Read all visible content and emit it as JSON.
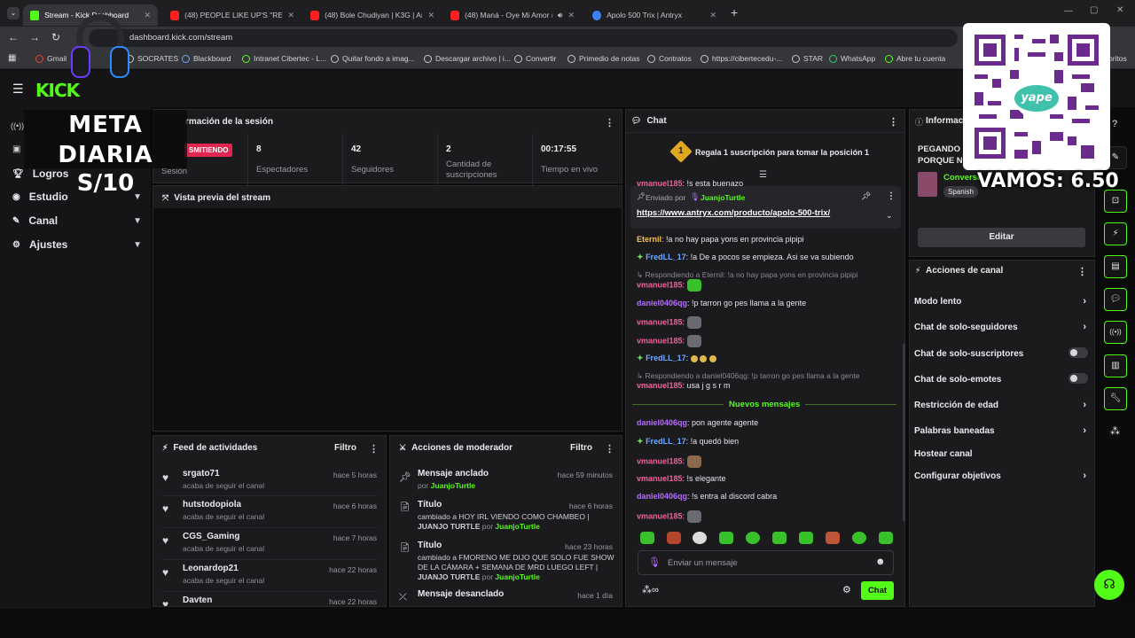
{
  "browser": {
    "tabs": [
      {
        "title": "Stream - Kick Dashboard",
        "icon": "kick"
      },
      {
        "title": "(48) PEOPLE LIKE UP'S \"REENCA",
        "icon": "youtube"
      },
      {
        "title": "(48) Bole Chudiyan | K3G | Ami",
        "icon": "youtube"
      },
      {
        "title": "(48) Maná - Oye Mi Amor (",
        "icon": "youtube"
      },
      {
        "title": "Apolo 500 Trix | Antryx",
        "icon": "antryx"
      }
    ],
    "url": "dashboard.kick.com/stream",
    "bookmarks": [
      "Gmail",
      "SOCRATES",
      "Blackboard",
      "Intranet Cibertec - L...",
      "Quitar fondo a imag...",
      "Descargar archivo | i...",
      "Convertir",
      "Primedio de notas",
      "Contratos",
      "https://cibertecedu-...",
      "STAR",
      "WhatsApp",
      "Abre tu cuenta",
      "oritos"
    ]
  },
  "overlay": {
    "goal_title": "META DIARIA",
    "goal_amount": "S/10",
    "vamos": "VAMOS: 6.50",
    "yape": "yape"
  },
  "nav": {
    "items": [
      {
        "label": "Logros",
        "chev": false
      },
      {
        "label": "Estudio",
        "chev": true
      },
      {
        "label": "Canal",
        "chev": true
      },
      {
        "label": "Ajustes",
        "chev": true
      }
    ]
  },
  "session": {
    "title": "rmación de la sesión",
    "live_badge": "SMITIENDO",
    "session_label": "Sesión",
    "stats": [
      {
        "value": "8",
        "label": "Espectadores"
      },
      {
        "value": "42",
        "label": "Seguidores"
      },
      {
        "value": "2",
        "label": "Cantidad de suscripciones"
      },
      {
        "value": "00:17:55",
        "label": "Tiempo en vivo"
      }
    ]
  },
  "preview": {
    "title": "Vista previa del stream"
  },
  "activity": {
    "title": "Feed de actividades",
    "filter": "Filtro",
    "items": [
      {
        "name": "srgato71",
        "sub": "acaba de seguir el canal",
        "time": "hace 5 horas"
      },
      {
        "name": "hutstodopiola",
        "sub": "acaba de seguir el canal",
        "time": "hace 6 horas"
      },
      {
        "name": "CGS_Gaming",
        "sub": "acaba de seguir el canal",
        "time": "hace 7 horas"
      },
      {
        "name": "Leonardop21",
        "sub": "acaba de seguir el canal",
        "time": "hace 22 horas"
      },
      {
        "name": "Davten",
        "sub": "",
        "time": "hace 22 horas"
      }
    ]
  },
  "moderator": {
    "title": "Acciones de moderador",
    "filter": "Filtro",
    "items": [
      {
        "name": "Mensaje anclado",
        "line1": "por",
        "user": "JuanjoTurtle",
        "time": "hace 59 minutos"
      },
      {
        "name": "Título",
        "line1": "cambiado a HOY IRL VIENDO COMO CHAMBEO |",
        "line2": "JUANJO TURTLE",
        "by": "por",
        "user": "JuanjoTurtle",
        "time": "hace 6 horas"
      },
      {
        "name": "Título",
        "line1": "cambiado a FMORENO ME DIJO QUE SOLO FUE SHOW",
        "line2": "DE LA CÁMARA + SEMANA DE MRD LUEGO LEFT |",
        "line3": "JUANJO TURTLE",
        "by": "por",
        "user": "JuanjoTurtle",
        "time": "hace 23 horas"
      },
      {
        "name": "Mensaje desanclado",
        "time": "hace 1 día"
      }
    ]
  },
  "chat": {
    "title": "Chat",
    "sub_banner": "Regala 1 suscripción para tomar la posición 1",
    "sub_rank": "1",
    "top_msg": {
      "user": "vmanuel185",
      "text": ": !s esta buenazo"
    },
    "pinned": {
      "sent_by": "Enviado por",
      "user": "JuanjoTurtle",
      "link": "https://www.antryx.com/producto/apolo-500-trix/"
    },
    "messages": [
      {
        "user": "Eternil",
        "color": "yellow",
        "text": ": !a no hay papa yons en provincia pipipi"
      },
      {
        "user": "FredLL_17",
        "color": "blue",
        "text": ": !a De a pocos se empieza. Asi se va subiendo",
        "badge": true
      },
      {
        "reply": "Respondiendo a Eternil: !a no hay papa yons en provincia pipipi"
      },
      {
        "user": "vmanuel185",
        "color": "pink",
        "text": ":",
        "emote": "g"
      },
      {
        "user": "daniel0406qg",
        "color": "purple",
        "text": ": !p tarron go pes llama a la gente"
      },
      {
        "user": "vmanuel185",
        "color": "pink",
        "text": ":",
        "emote": "gr"
      },
      {
        "user": "vmanuel185",
        "color": "pink",
        "text": ":",
        "emote": "gr"
      },
      {
        "user": "FredLL_17",
        "color": "blue",
        "text": ":",
        "badge": true,
        "emote": "y"
      },
      {
        "reply": "Respondiendo a daniel0406qg: !p tarron go pes llama a la gente"
      },
      {
        "user": "vmanuel185",
        "color": "pink",
        "text": ": usa j g s r m"
      }
    ],
    "new_messages": "Nuevos mensajes",
    "messages2": [
      {
        "user": "daniel0406qg",
        "color": "purple",
        "text": ": pon agente agente"
      },
      {
        "user": "FredLL_17",
        "color": "blue",
        "text": ": !a quedó bien",
        "badge": true
      },
      {
        "user": "vmanuel185",
        "color": "pink",
        "text": ":",
        "emote": "br"
      },
      {
        "user": "vmanuel185",
        "color": "pink",
        "text": ": !s elegante"
      },
      {
        "user": "daniel0406qg",
        "color": "purple",
        "text": ": !s entra al discord cabra"
      },
      {
        "user": "vmanuel185",
        "color": "pink",
        "text": ":",
        "emote": "gr"
      }
    ],
    "input_placeholder": "Enviar un mensaje",
    "send": "Chat"
  },
  "info": {
    "title": "Informac",
    "stream_title1": "PEGANDO I",
    "stream_title2": "PORQUE N",
    "category": "Conversa",
    "language": "Spanish",
    "edit": "Editar"
  },
  "channel_actions": {
    "title": "Acciones de canal",
    "items": [
      {
        "label": "Modo lento",
        "type": "chev"
      },
      {
        "label": "Chat de solo-seguidores",
        "type": "chev"
      },
      {
        "label": "Chat de solo-suscriptores",
        "type": "toggle"
      },
      {
        "label": "Chat de solo-emotes",
        "type": "toggle"
      },
      {
        "label": "Restricción de edad",
        "type": "chev"
      },
      {
        "label": "Palabras baneadas",
        "type": "chev"
      },
      {
        "label": "Hostear canal",
        "type": "none"
      },
      {
        "label": "Configurar objetivos",
        "type": "chev"
      }
    ]
  },
  "colors": {
    "accent": "#53fc18",
    "pink": "#f0609a",
    "purple": "#b46dff",
    "blue": "#6fa8ff",
    "yellow": "#f6c24a",
    "live": "#e0254f"
  }
}
